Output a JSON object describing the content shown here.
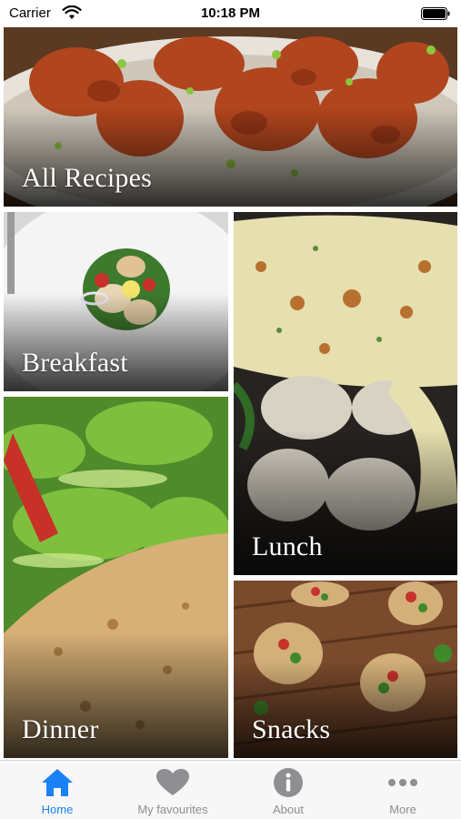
{
  "status_bar": {
    "carrier": "Carrier",
    "time": "10:18 PM",
    "wifi_icon": "wifi-icon",
    "battery_icon": "battery-icon"
  },
  "categories": [
    {
      "id": "all",
      "label": "All Recipes",
      "photo": "roasted chicken pieces on plate"
    },
    {
      "id": "breakfast",
      "label": "Breakfast",
      "photo": "salad on white plate"
    },
    {
      "id": "lunch",
      "label": "Lunch",
      "photo": "flatbread wrap with chicken"
    },
    {
      "id": "dinner",
      "label": "Dinner",
      "photo": "grilled fish with green salad"
    },
    {
      "id": "snacks",
      "label": "Snacks",
      "photo": "stuffed mushrooms on wooden board"
    }
  ],
  "tab_bar": {
    "active": "Home",
    "tabs": [
      {
        "label": "Home",
        "icon": "home-icon"
      },
      {
        "label": "My favourites",
        "icon": "heart-icon"
      },
      {
        "label": "About",
        "icon": "info-icon"
      },
      {
        "label": "More",
        "icon": "more-icon"
      }
    ]
  },
  "colors": {
    "accent": "#1a82f5",
    "tab_inactive": "#8e8e93",
    "tab_bar_bg": "#f7f7f7"
  }
}
